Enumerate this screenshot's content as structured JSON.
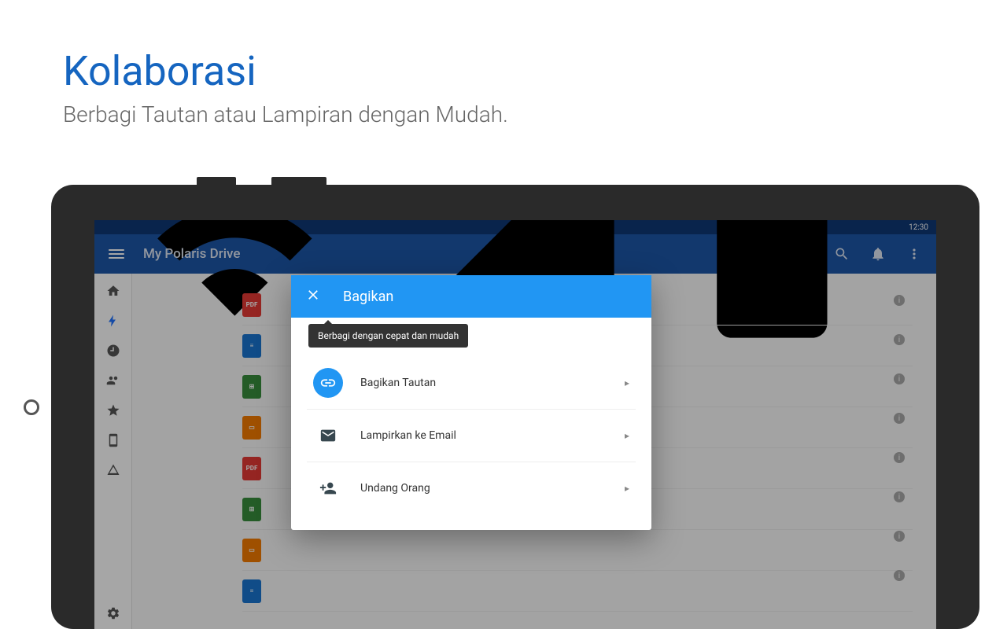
{
  "promo": {
    "title": "Kolaborasi",
    "subtitle": "Berbagi Tautan atau Lampiran dengan Mudah."
  },
  "status": {
    "time": "12:30"
  },
  "appbar": {
    "title": "My Polaris Drive"
  },
  "sidebar": {
    "icons": [
      "home",
      "drive",
      "recent",
      "shared",
      "favorite",
      "device",
      "cloud"
    ]
  },
  "files": [
    {
      "type": "pdf",
      "label": "PDF"
    },
    {
      "type": "doc",
      "label": ""
    },
    {
      "type": "sheet",
      "label": ""
    },
    {
      "type": "slide",
      "label": ""
    },
    {
      "type": "pdf",
      "label": "PDF"
    },
    {
      "type": "sheet",
      "label": ""
    },
    {
      "type": "slide",
      "label": ""
    },
    {
      "type": "doc",
      "label": ""
    }
  ],
  "dialog": {
    "title": "Bagikan",
    "tooltip": "Berbagi dengan cepat dan mudah",
    "options": [
      {
        "icon": "link",
        "label": "Bagikan Tautan"
      },
      {
        "icon": "mail",
        "label": "Lampirkan ke Email"
      },
      {
        "icon": "person",
        "label": "Undang Orang"
      }
    ]
  }
}
